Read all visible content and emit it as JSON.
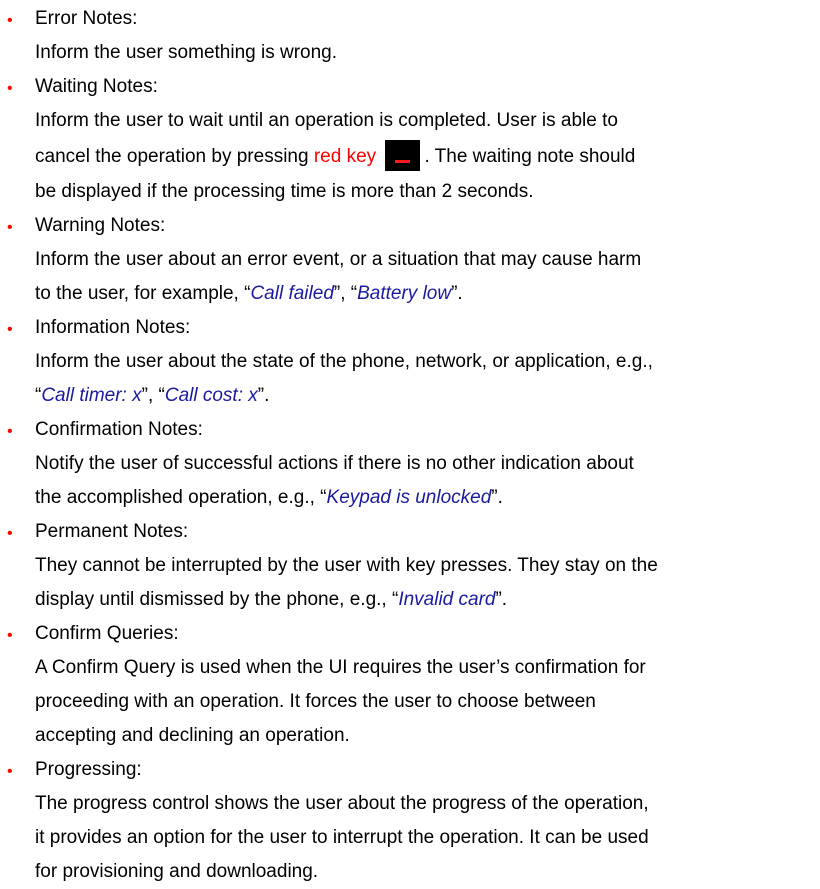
{
  "accent_colors": {
    "bullet": "#ff0000",
    "quote": "#1a1aa0",
    "highlight": "#ff0000"
  },
  "icons": {
    "bullet": "bullet-dot-icon",
    "red_key": "red-key-icon"
  },
  "items": [
    {
      "bullet": "•",
      "heading": "Error Notes:",
      "lines": [
        "Inform the user something is wrong."
      ]
    },
    {
      "bullet": "•",
      "heading": "Waiting Notes:",
      "line1": "Inform the user to wait until an operation is completed. User is able to",
      "line2_pre": "cancel the operation by pressing ",
      "line2_red": "red key",
      "line2_post": ". The waiting note should",
      "line3": "be displayed if the processing time is more than 2 seconds."
    },
    {
      "bullet": "•",
      "heading": "Warning Notes:",
      "line1": "Inform the user about an error event, or a situation that may cause harm",
      "line2_pre": "to the user, for example, “",
      "q1": "Call failed",
      "mid": "”, “",
      "q2": "Battery low",
      "end": "”."
    },
    {
      "bullet": "•",
      "heading": "Information Notes:",
      "line1": "Inform the user about the state of the phone, network, or application, e.g.,",
      "open": "“",
      "q1": "Call timer: x",
      "mid": "”, “",
      "q2": "Call cost: x",
      "end": "”."
    },
    {
      "bullet": "•",
      "heading": "Confirmation Notes:",
      "line1": "Notify the user of successful actions if there is no other indication about",
      "line2_pre": "the accomplished operation, e.g., “",
      "q1": "Keypad is unlocked",
      "end": "”."
    },
    {
      "bullet": "•",
      "heading": "Permanent Notes:",
      "line1": "They cannot be interrupted by the user with key presses. They stay on the",
      "line2_pre": "display until dismissed by the phone, e.g., “",
      "q1": "Invalid card",
      "end": "”."
    },
    {
      "bullet": "•",
      "heading": "Confirm Queries:",
      "lines": [
        "A Confirm Query is used when the UI requires the user’s confirmation for",
        "proceeding with an operation. It forces the user to choose between",
        "accepting and declining an operation."
      ]
    },
    {
      "bullet": "•",
      "heading": "Progressing:",
      "lines": [
        "The progress control shows the user about the progress of the operation,",
        "it provides an option for the user to interrupt the operation. It can be used",
        "for provisioning and downloading."
      ]
    }
  ]
}
